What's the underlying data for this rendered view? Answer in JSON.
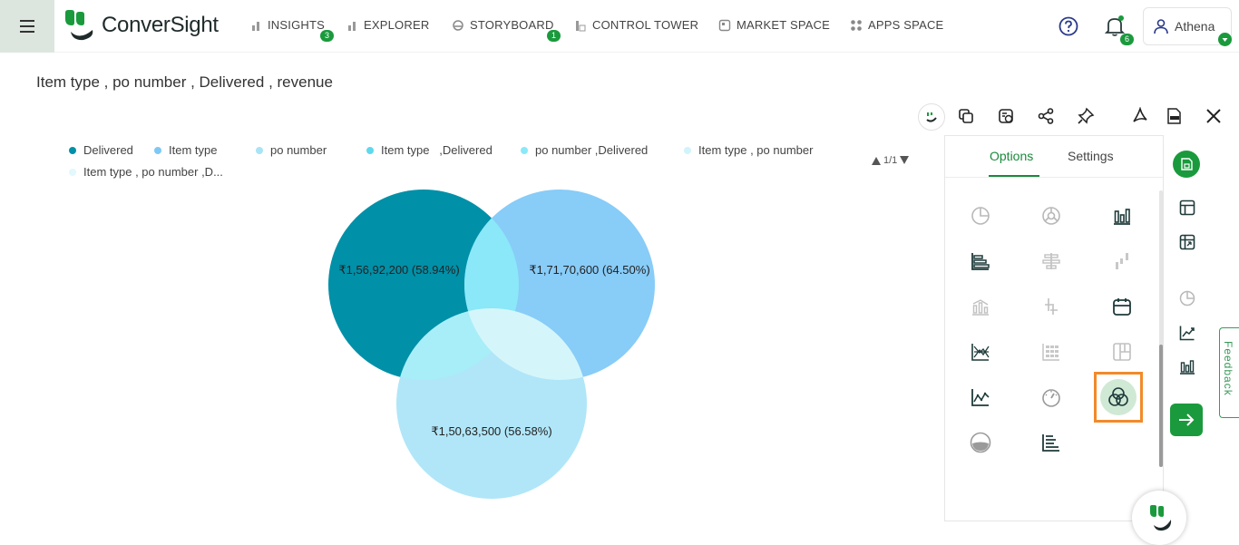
{
  "app": {
    "logo_text": "ConverSight"
  },
  "nav": [
    {
      "label": "INSIGHTS",
      "badge": "3"
    },
    {
      "label": "EXPLORER"
    },
    {
      "label": "STORYBOARD",
      "badge": "1"
    },
    {
      "label": "CONTROL TOWER"
    },
    {
      "label": "MARKET SPACE"
    },
    {
      "label": "APPS SPACE"
    }
  ],
  "header": {
    "notifications_badge": "6",
    "user_name": "Athena"
  },
  "page": {
    "title": "Item type , po number , Delivered , revenue"
  },
  "legend": [
    {
      "label": "Delivered",
      "color": "#0090a8"
    },
    {
      "label": "Item type",
      "color": "#7fc8f5"
    },
    {
      "label": "po number",
      "color": "#a8e4f6"
    },
    {
      "label": "Item type   ,Delivered",
      "color": "#5fd8ee"
    },
    {
      "label": "po number ,Delivered",
      "color": "#8ae8f8"
    },
    {
      "label": "Item type , po number",
      "color": "#d0f4fb"
    },
    {
      "label": "Item type , po number ,D...",
      "color": "#e2f8fc"
    }
  ],
  "pager": {
    "text": "1/1"
  },
  "chart_data": {
    "type": "venn",
    "sets": [
      {
        "name": "Delivered",
        "label": "₹1,56,92,200 (58.94%)",
        "color": "#0090a8"
      },
      {
        "name": "Item type",
        "label": "₹1,71,70,600 (64.50%)",
        "color": "#88ccf8"
      },
      {
        "name": "po number",
        "label": "₹1,50,63,500 (56.58%)",
        "color": "#b0e6f8"
      }
    ],
    "intersection_colors": {
      "delivered_item_type": "#8ae8f8",
      "delivered_po_number": "#a8eef8",
      "item_type_po_number": "#d4f6fb"
    }
  },
  "panel": {
    "tabs": [
      "Options",
      "Settings"
    ],
    "active_tab": "Options",
    "chart_types": [
      "pie-chart-icon",
      "donut-chart-icon",
      "column-chart-icon",
      "bar-chart-icon",
      "diverging-bar-icon",
      "waterfall-icon",
      "combo-chart-icon",
      "error-bar-icon",
      "calendar-icon",
      "multi-line-icon",
      "matrix-icon",
      "treemap-icon",
      "line-chart-icon",
      "gauge-icon",
      "venn-diagram-icon",
      "liquid-gauge-icon",
      "stacked-bar-icon"
    ],
    "selected_chart": "venn-diagram-icon",
    "highlight_color": "#f28a2a"
  },
  "feedback": {
    "label": "Feedback"
  },
  "colors": {
    "brand_green": "#1a9a3c",
    "accent": "#1a8a3c"
  }
}
